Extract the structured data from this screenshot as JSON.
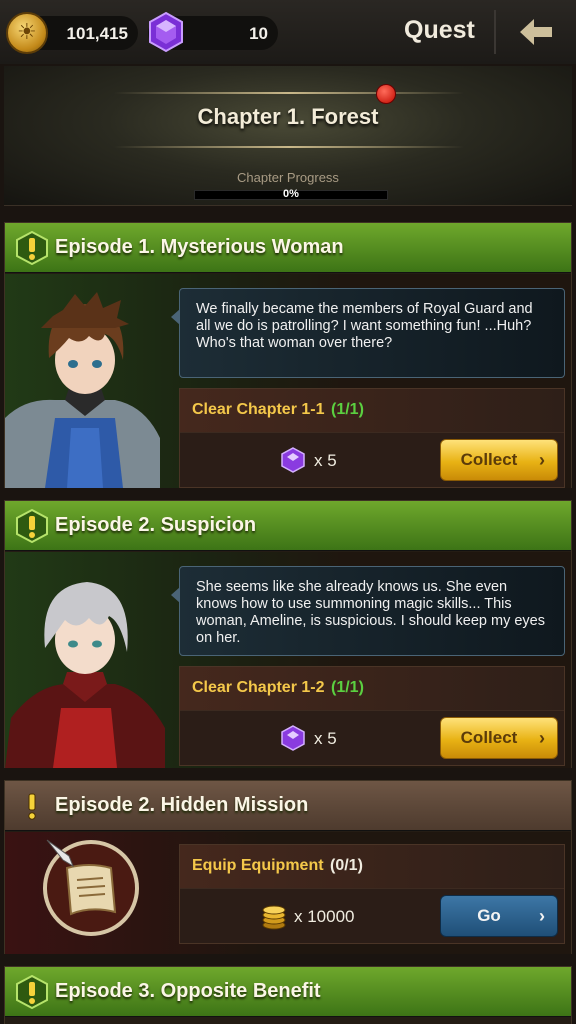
{
  "header": {
    "gold": "101,415",
    "gems": "10",
    "title": "Quest",
    "back_icon": "back-arrow-icon"
  },
  "chapter": {
    "title": "Chapter 1. Forest",
    "progress_label": "Chapter Progress",
    "progress_text": "0%",
    "progress_value": 0
  },
  "episodes": [
    {
      "title": "Episode 1. Mysterious Woman",
      "dialog": "We finally became the members of Royal Guard and all we do is patrolling? I want something fun! ...Huh? Who's that woman over there?",
      "mission": "Clear Chapter 1-1",
      "progress": "(1/1)",
      "reward_qty": "x 5",
      "reward_icon": "gem-icon",
      "button": "Collect"
    },
    {
      "title": "Episode 2. Suspicion",
      "dialog": "She seems like she already knows us. She even knows how to use summoning magic skills... This woman, Ameline, is suspicious. I should keep my eyes on her.",
      "mission": "Clear Chapter 1-2",
      "progress": "(1/1)",
      "reward_qty": "x 5",
      "reward_icon": "gem-icon",
      "button": "Collect"
    },
    {
      "title": "Episode 2. Hidden Mission",
      "mission": "Equip Equipment",
      "progress": "(0/1)",
      "reward_qty": "x 10000",
      "reward_icon": "gold-coins-icon",
      "button": "Go"
    },
    {
      "title": "Episode 3. Opposite Benefit"
    }
  ],
  "colors": {
    "accent_green": "#5a9624",
    "mission_yellow": "#f4c84a",
    "done_green": "#5bd040"
  }
}
